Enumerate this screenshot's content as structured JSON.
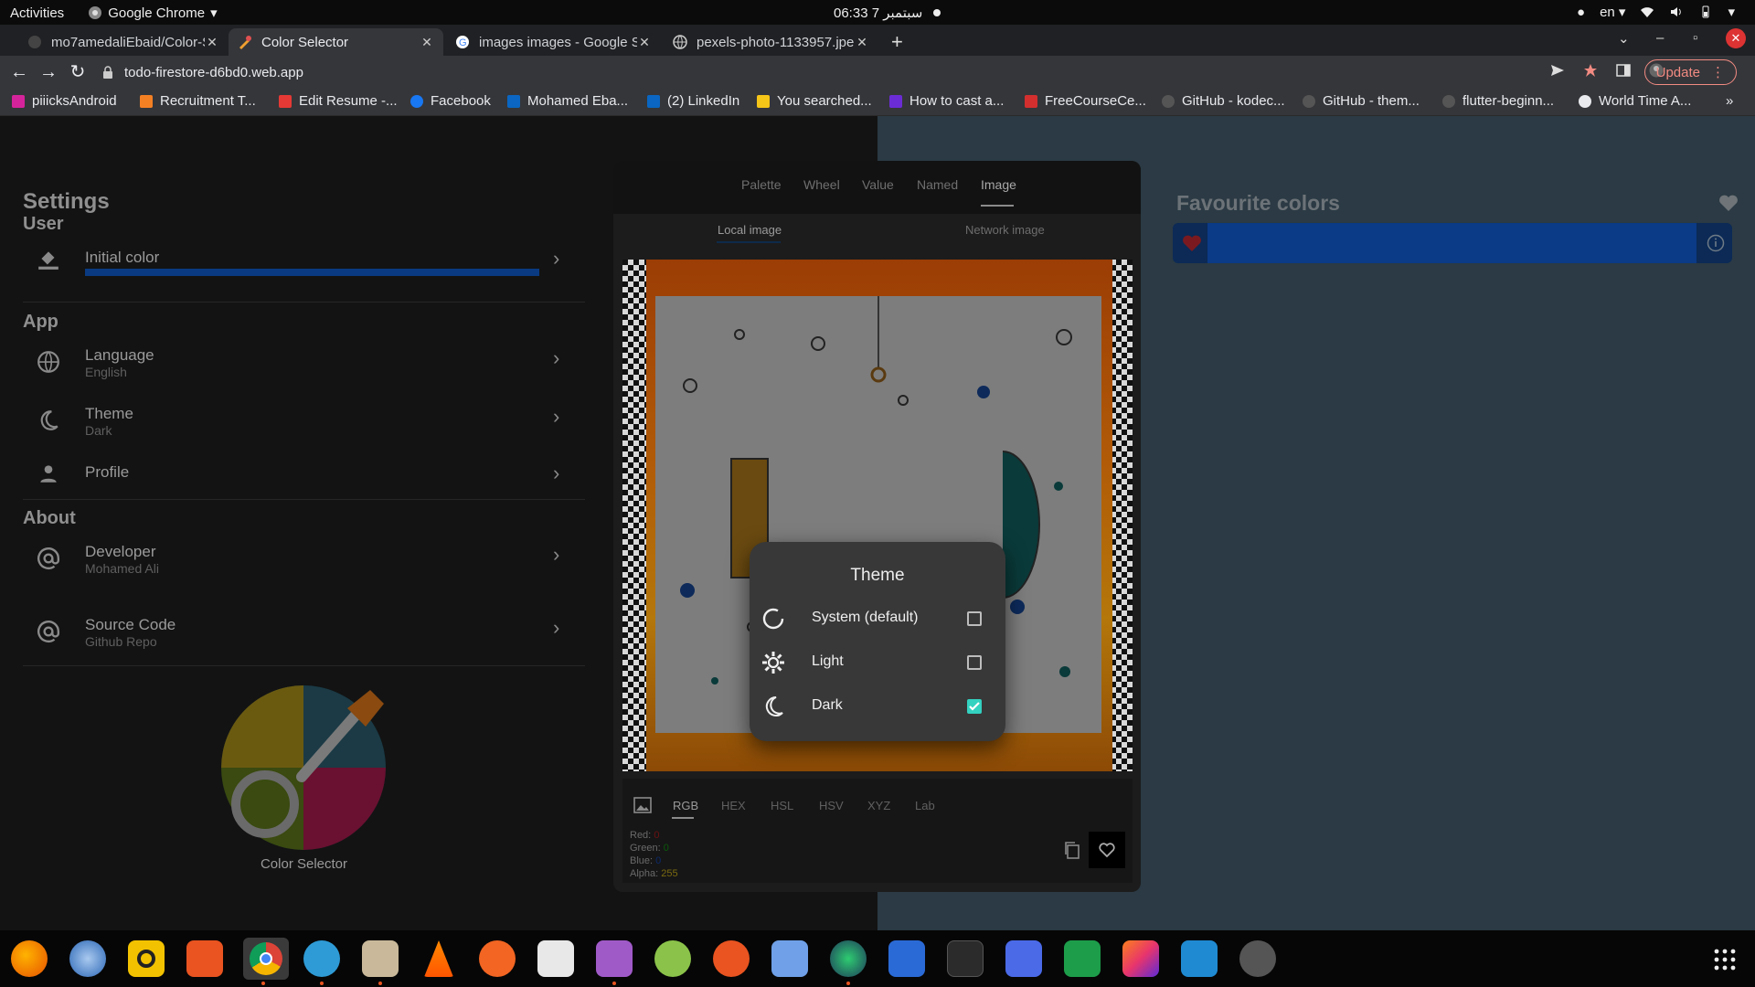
{
  "topbar": {
    "activities": "Activities",
    "app_name": "Google Chrome",
    "clock": "06:33  7 سبتمبر",
    "lang": "en"
  },
  "tabs": [
    {
      "title": "mo7amedaliEbaid/Color-S",
      "active": false
    },
    {
      "title": "Color Selector",
      "active": true
    },
    {
      "title": "images images - Google S",
      "active": false
    },
    {
      "title": "pexels-photo-1133957.jpe",
      "active": false
    }
  ],
  "address": {
    "url": "todo-firestore-d6bd0.web.app",
    "update_label": "Update"
  },
  "bookmarks": [
    {
      "label": "piiicksAndroid",
      "color": "#d5249b"
    },
    {
      "label": "Recruitment T...",
      "color": "#f48024"
    },
    {
      "label": "Edit Resume -...",
      "color": "#e53935"
    },
    {
      "label": "Facebook",
      "color": "#1877f2"
    },
    {
      "label": "Mohamed Eba...",
      "color": "#0a66c2"
    },
    {
      "label": "(2) LinkedIn",
      "color": "#0a66c2"
    },
    {
      "label": "You searched...",
      "color": "#f5c518"
    },
    {
      "label": "How to cast a...",
      "color": "#6b2cd6"
    },
    {
      "label": "FreeCourseCe...",
      "color": "#d32f2f"
    },
    {
      "label": "GitHub - kodec...",
      "color": "#555555"
    },
    {
      "label": "GitHub - them...",
      "color": "#555555"
    },
    {
      "label": "flutter-beginn...",
      "color": "#555555"
    },
    {
      "label": "World Time A...",
      "color": "#e8eaed"
    }
  ],
  "settings": {
    "title": "Settings",
    "user_section": "User",
    "initial_color": "Initial color",
    "app_section": "App",
    "language": {
      "title": "Language",
      "value": "English"
    },
    "theme": {
      "title": "Theme",
      "value": "Dark"
    },
    "profile": "Profile",
    "about_section": "About",
    "developer": {
      "title": "Developer",
      "value": "Mohamed Ali"
    },
    "source": {
      "title": "Source Code",
      "value": "Github Repo"
    },
    "logo_caption": "Color Selector"
  },
  "picker": {
    "tabs": [
      "Palette",
      "Wheel",
      "Value",
      "Named",
      "Image"
    ],
    "active_tab": "Image",
    "subtabs": [
      "Local image",
      "Network image"
    ],
    "format_tabs": [
      "RGB",
      "HEX",
      "HSL",
      "HSV",
      "XYZ",
      "Lab"
    ],
    "values": {
      "red_label": "Red:",
      "red": "0",
      "green_label": "Green:",
      "green": "0",
      "blue_label": "Blue:",
      "blue": "0",
      "alpha_label": "Alpha:",
      "alpha": "255"
    }
  },
  "dialog": {
    "title": "Theme",
    "options": [
      {
        "label": "System (default)",
        "checked": false
      },
      {
        "label": "Light",
        "checked": false
      },
      {
        "label": "Dark",
        "checked": true
      }
    ]
  },
  "favourites": {
    "title": "Favourite colors",
    "color": "#0b3a86"
  },
  "colors": {
    "accent_teal": "#33d1c0",
    "favourite_blue": "#0b3a86",
    "chrome_update": "#f28b82"
  }
}
